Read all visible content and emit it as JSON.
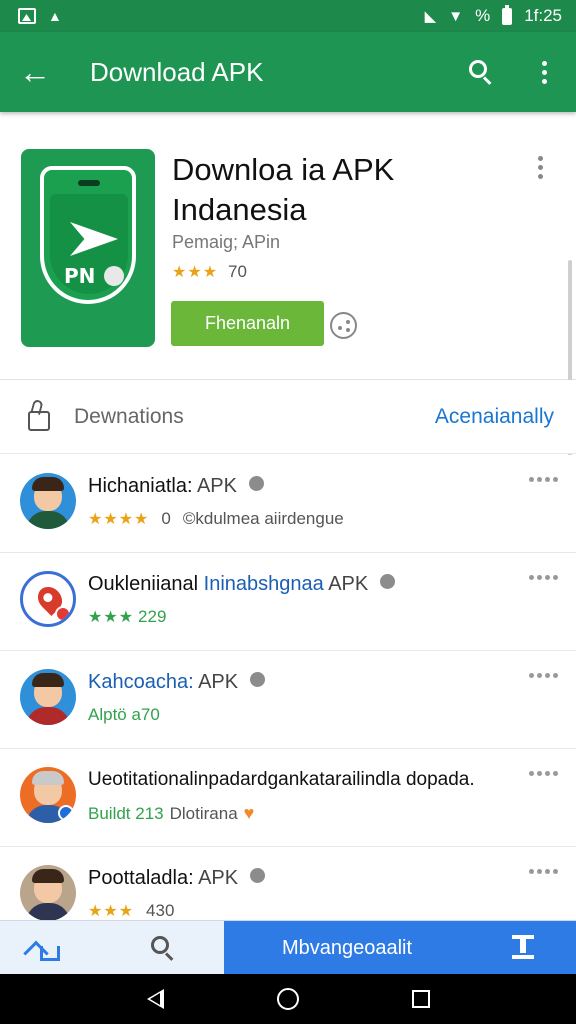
{
  "status_bar": {
    "time": "1f:25",
    "signal_text": "%"
  },
  "app_bar": {
    "title": "Download APK"
  },
  "app": {
    "name": "Downloa ia APK Indanesia",
    "developer": "Pemaig; APin",
    "rating_stars": "★★★",
    "rating_value": "70",
    "install_label": "Fhenanaln",
    "icon_text": "PN"
  },
  "section": {
    "title": "Dewnations",
    "link": "Acenaianally"
  },
  "items": [
    {
      "title": "Hichaniatla:",
      "title_accent": "",
      "apk": "APK",
      "stars": "★★★★",
      "num": "0",
      "extra": "©kdulmea aiirdengue",
      "stars_color": "gold"
    },
    {
      "title": "Oukleniianal",
      "title_accent": "Ininabshgnaa",
      "apk": "APK",
      "stars": "★★★",
      "num": "229",
      "extra": "",
      "stars_color": "green"
    },
    {
      "title": "",
      "title_accent": "Kahcoacha:",
      "apk": "APK",
      "stars": "",
      "num": "Alptö a70",
      "extra": "",
      "stars_color": "green"
    },
    {
      "title": "Ueotitationalinpadardgankatarailindla dopada.",
      "title_accent": "",
      "apk": "",
      "stars": "",
      "num": "Buildt 213",
      "extra": "Dlotirana",
      "stars_color": "green"
    },
    {
      "title": "Poottaladla:",
      "title_accent": "",
      "apk": "APK",
      "stars": "★★★",
      "num": "430",
      "extra": "",
      "stars_color": "gold"
    }
  ],
  "bottom_nav": {
    "center_label": "Mbvangeoaalit"
  },
  "colors": {
    "primary_green": "#1f9553",
    "install_green": "#6ab73a",
    "link_blue": "#1976d2",
    "nav_blue": "#2f7be6"
  }
}
